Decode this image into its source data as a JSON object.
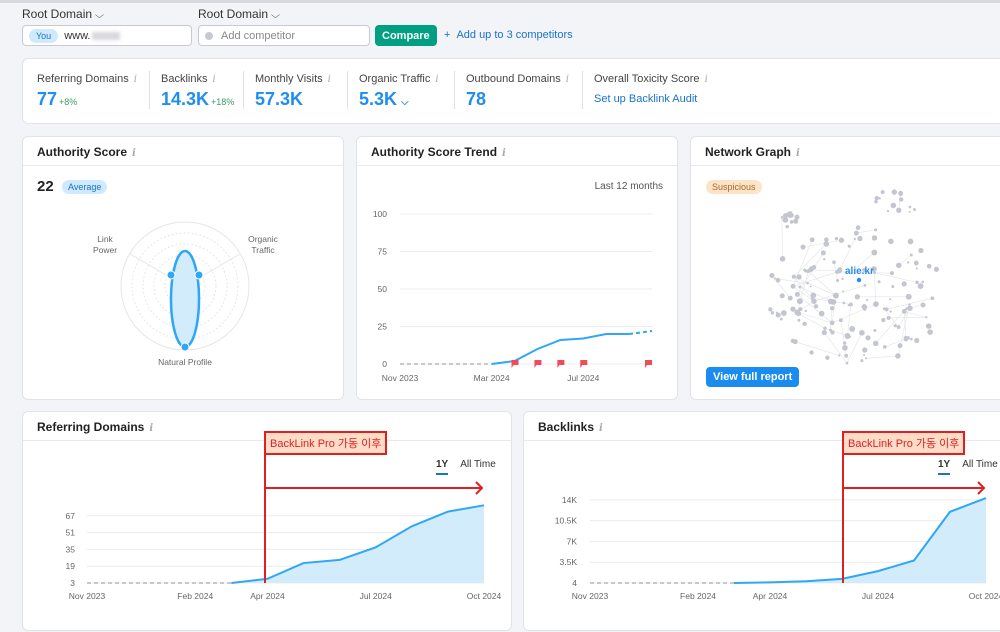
{
  "compare_bar": {
    "dropdown_1": "Root Domain",
    "dropdown_2": "Root Domain",
    "you_badge": "You",
    "your_domain": "www.",
    "competitor_placeholder": "Add competitor",
    "compare_button": "Compare",
    "add_competitors_link": "Add up to 3 competitors"
  },
  "metrics": [
    {
      "label": "Referring Domains",
      "value": "77",
      "delta": "+8%"
    },
    {
      "label": "Backlinks",
      "value": "14.3K",
      "delta": "+18%"
    },
    {
      "label": "Monthly Visits",
      "value": "57.3K",
      "delta": ""
    },
    {
      "label": "Organic Traffic",
      "value": "5.3K",
      "delta": ""
    },
    {
      "label": "Outbound Domains",
      "value": "78",
      "delta": ""
    },
    {
      "label": "Overall Toxicity Score",
      "link": "Set up Backlink Audit"
    }
  ],
  "authority_score": {
    "title": "Authority Score",
    "score": "22",
    "badge": "Average",
    "axes": [
      "Link Power",
      "Organic Traffic",
      "Natural Profile"
    ],
    "axis_lines": {
      "link_1": "Link",
      "link_2": "Power",
      "org_1": "Organic",
      "org_2": "Traffic"
    }
  },
  "authority_trend": {
    "title": "Authority Score Trend",
    "period": "Last 12 months"
  },
  "network_graph": {
    "title": "Network Graph",
    "badge": "Suspicious",
    "center_label": "alie.kr",
    "button": "View full report"
  },
  "referring_domains_card": {
    "title": "Referring Domains",
    "range_1y": "1Y",
    "range_all": "All Time",
    "annotation": "BackLink Pro 가동 이후"
  },
  "backlinks_card": {
    "title": "Backlinks",
    "range_1y": "1Y",
    "range_all": "All Time",
    "annotation": "BackLink Pro 가동 이후"
  },
  "colors": {
    "accent": "#1f8ef0",
    "line": "#2fa7f5",
    "fill": "#d2ecfc",
    "annotation": "#e02020",
    "compare": "#009f81"
  },
  "chart_data": [
    {
      "type": "line",
      "title": "Authority Score Trend",
      "x": [
        "Nov 2023",
        "Dec 2023",
        "Jan 2024",
        "Feb 2024",
        "Mar 2024",
        "Apr 2024",
        "May 2024",
        "Jun 2024",
        "Jul 2024",
        "Aug 2024",
        "Sep 2024",
        "Oct 2024"
      ],
      "xticks": [
        "Nov 2023",
        "Mar 2024",
        "Jul 2024"
      ],
      "values": [
        0,
        0,
        0,
        0,
        0,
        2,
        10,
        16,
        17,
        20,
        20,
        22
      ],
      "projected_from_index": 10,
      "yticks": [
        0,
        25,
        50,
        75,
        100
      ],
      "ylim": [
        0,
        100
      ],
      "flags_at": [
        "Apr 2024",
        "May 2024",
        "Jun 2024",
        "Jul 2024",
        "Oct 2024"
      ]
    },
    {
      "type": "area",
      "title": "Referring Domains",
      "x": [
        "Nov 2023",
        "Dec 2023",
        "Jan 2024",
        "Feb 2024",
        "Mar 2024",
        "Apr 2024",
        "May 2024",
        "Jun 2024",
        "Jul 2024",
        "Aug 2024",
        "Sep 2024",
        "Oct 2024"
      ],
      "xticks": [
        "Nov 2023",
        "Feb 2024",
        "Apr 2024",
        "Jul 2024",
        "Oct 2024"
      ],
      "values": [
        3,
        3,
        3,
        3,
        3,
        7,
        22,
        25,
        37,
        57,
        71,
        77
      ],
      "no_data_until_index": 4,
      "yticks": [
        3,
        19,
        35,
        51,
        67
      ],
      "ylim": [
        3,
        83
      ],
      "annotation_at": "Apr 2024"
    },
    {
      "type": "area",
      "title": "Backlinks",
      "x": [
        "Nov 2023",
        "Dec 2023",
        "Jan 2024",
        "Feb 2024",
        "Mar 2024",
        "Apr 2024",
        "May 2024",
        "Jun 2024",
        "Jul 2024",
        "Aug 2024",
        "Sep 2024",
        "Oct 2024"
      ],
      "xticks": [
        "Nov 2023",
        "Feb 2024",
        "Apr 2024",
        "Jul 2024",
        "Oct 2024"
      ],
      "values": [
        4,
        4,
        4,
        4,
        4,
        100,
        300,
        700,
        2000,
        3800,
        12000,
        14300
      ],
      "no_data_until_index": 4,
      "yticks": [
        "4",
        "3.5K",
        "7K",
        "10.5K",
        "14K"
      ],
      "ytick_values": [
        4,
        3500,
        7000,
        10500,
        14000
      ],
      "ylim": [
        4,
        16000
      ],
      "annotation_at": "Jun 2024"
    }
  ]
}
